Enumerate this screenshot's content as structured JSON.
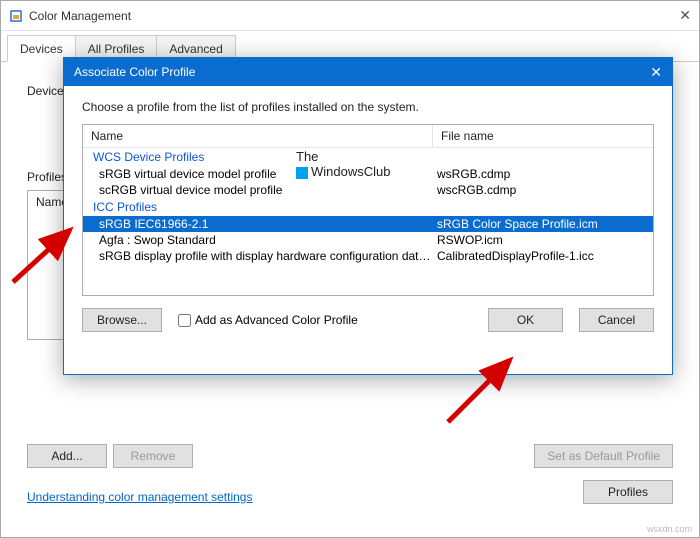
{
  "main": {
    "title": "Color Management",
    "tabs": [
      "Devices",
      "All Profiles",
      "Advanced"
    ],
    "active_tab": 0,
    "device_label": "Device",
    "profiles_label": "Profiles",
    "profiles_header": "Name",
    "buttons": {
      "add": "Add...",
      "remove": "Remove",
      "set_default": "Set as Default Profile",
      "profiles_btn": "Profiles"
    },
    "link": "Understanding color management settings"
  },
  "modal": {
    "title": "Associate Color Profile",
    "desc": "Choose a profile from the list of profiles installed on the system.",
    "columns": {
      "name": "Name",
      "file": "File name"
    },
    "groups": [
      {
        "label": "WCS Device Profiles",
        "rows": [
          {
            "name": "sRGB virtual device model profile",
            "file": "wsRGB.cdmp"
          },
          {
            "name": "scRGB virtual device model profile",
            "file": "wscRGB.cdmp"
          }
        ]
      },
      {
        "label": "ICC Profiles",
        "rows": [
          {
            "name": "sRGB IEC61966-2.1",
            "file": "sRGB Color Space Profile.icm",
            "selected": true
          },
          {
            "name": "Agfa : Swop Standard",
            "file": "RSWOP.icm"
          },
          {
            "name": "sRGB display profile with display hardware configuration data deriv...",
            "file": "CalibratedDisplayProfile-1.icc"
          }
        ]
      }
    ],
    "browse": "Browse...",
    "advanced_checkbox": "Add as Advanced Color Profile",
    "ok": "OK",
    "cancel": "Cancel"
  },
  "watermark": {
    "line1": "The",
    "line2": "WindowsClub"
  },
  "wsxdn": "wsxdn.com"
}
